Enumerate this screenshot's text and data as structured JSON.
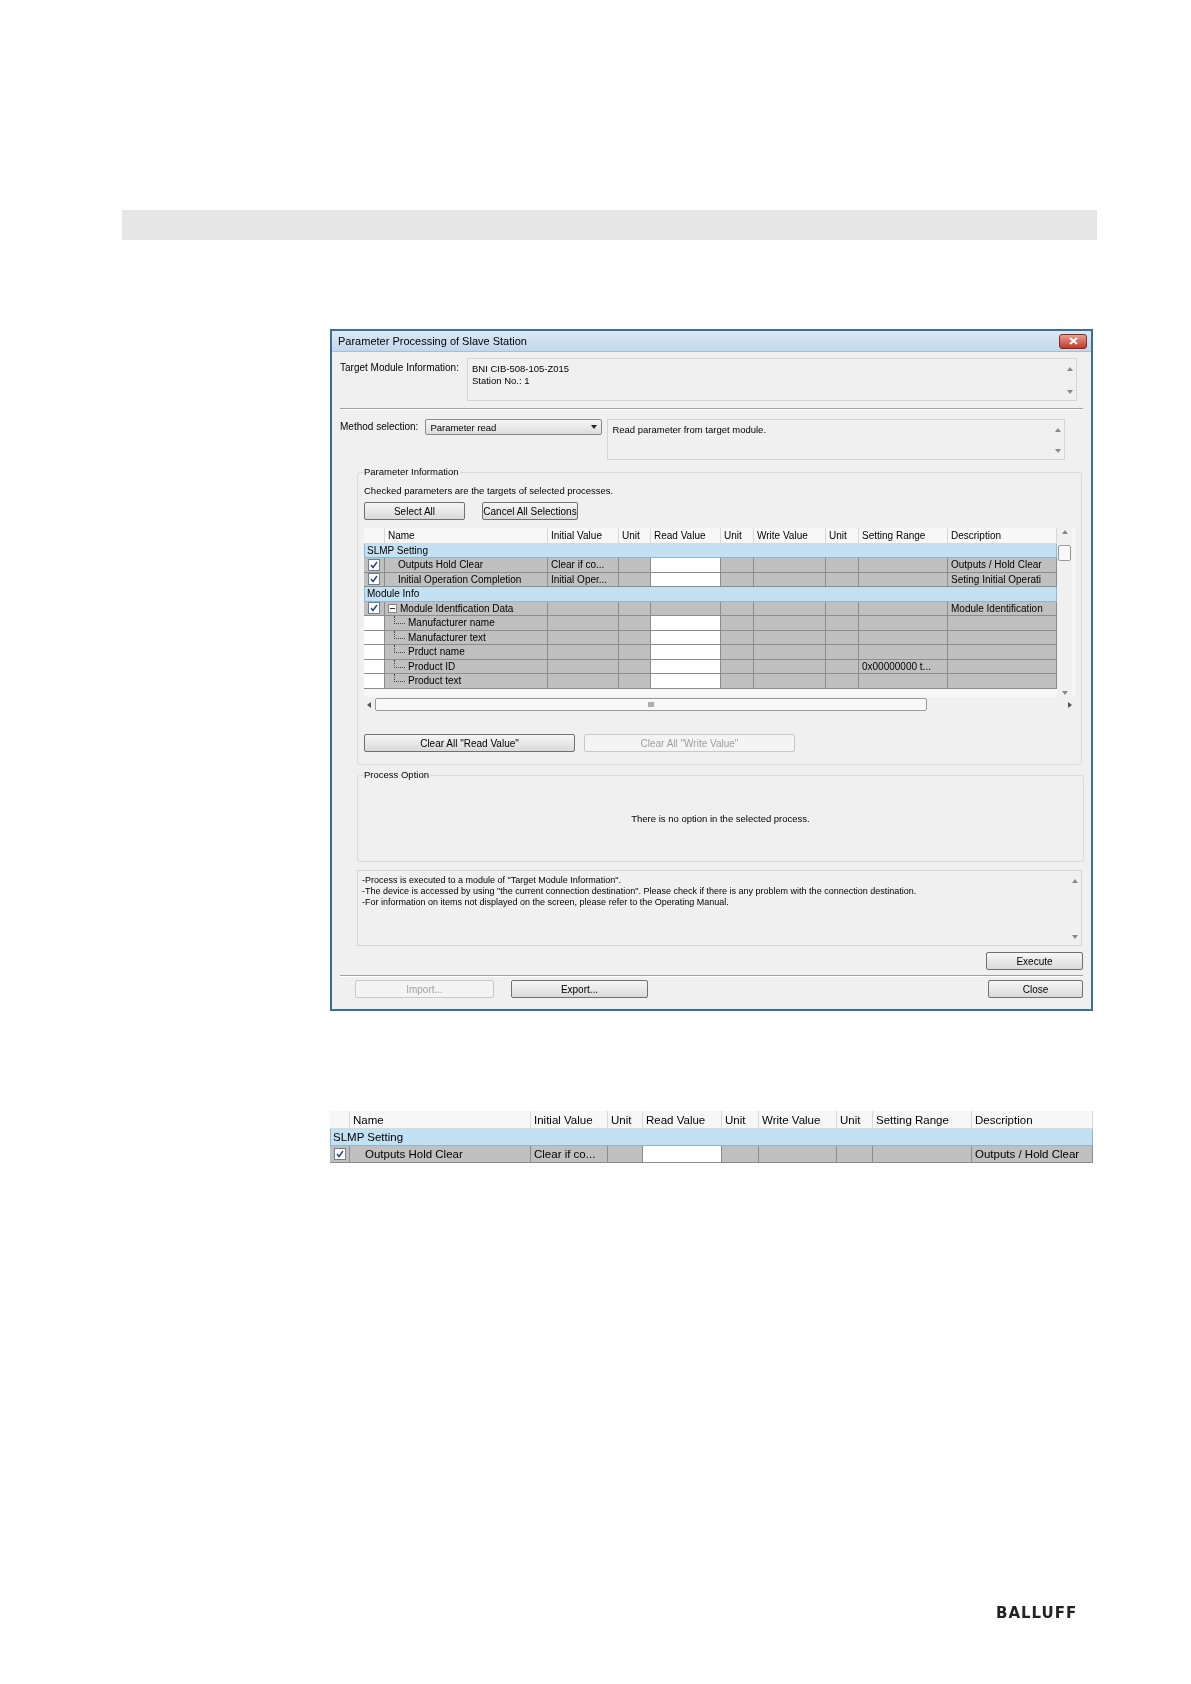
{
  "dialog": {
    "title": "Parameter Processing of Slave Station",
    "target_module": {
      "label": "Target Module Information:",
      "lines": [
        "BNI CIB-508-105-Z015",
        "Station No.: 1"
      ]
    },
    "method": {
      "label": "Method selection:",
      "value": "Parameter read",
      "description": "Read parameter from target module."
    },
    "parameter_information": {
      "title": "Parameter Information",
      "hint": "Checked parameters are the targets of selected processes.",
      "buttons": [
        {
          "label": "Select All",
          "disabled": false
        },
        {
          "label": "Cancel All Selections",
          "disabled": false
        }
      ],
      "table": {
        "columns": [
          "Name",
          "Initial Value",
          "Unit",
          "Read Value",
          "Unit",
          "Write Value",
          "Unit",
          "Setting Range",
          "Description"
        ],
        "groups": [
          {
            "group": "SLMP Setting",
            "parameters": [
              {
                "name": "Outputs Hold Clear",
                "checked": true,
                "initial_value": "Clear if co...",
                "read_editable": true,
                "description": "Outputs / Hold Clear"
              },
              {
                "name": "Initial Operation Completion",
                "checked": true,
                "initial_value": "Initial Oper...",
                "read_editable": true,
                "description": "Seting Initial Operati"
              }
            ]
          },
          {
            "group": "Module Info",
            "parameters": [
              {
                "name": "Module Identfication Data",
                "checked": true,
                "read_editable": false,
                "expanded": true,
                "description": "Module Identification",
                "children": [
                  {
                    "name": "Manufacturer name",
                    "read_editable": true
                  },
                  {
                    "name": "Manufacturer text",
                    "read_editable": true
                  },
                  {
                    "name": "Prduct name",
                    "read_editable": true
                  },
                  {
                    "name": "Product ID",
                    "read_editable": true,
                    "setting_range": "0x00000000 t..."
                  },
                  {
                    "name": "Product text",
                    "read_editable": true
                  }
                ]
              }
            ]
          }
        ]
      },
      "clear_buttons": [
        {
          "label": "Clear All \"Read Value\"",
          "disabled": false
        },
        {
          "label": "Clear All \"Write Value\"",
          "disabled": true
        }
      ]
    },
    "process_option": {
      "title": "Process Option",
      "message": "There is no option in the selected process."
    },
    "notes": [
      "-Process is executed to a module of \"Target Module Information\".",
      "-The device is accessed by using \"the current connection destination\". Please check if there is any problem with the connection destination.",
      "-For information on items not displayed on the screen, please refer to the Operating Manual."
    ],
    "execute_button": {
      "label": "Execute",
      "disabled": false
    },
    "footer_buttons": [
      {
        "label": "Import...",
        "disabled": true
      },
      {
        "label": "Export...",
        "disabled": false
      },
      {
        "label": "Close",
        "disabled": false
      }
    ]
  },
  "example_table": {
    "columns": [
      "Name",
      "Initial Value",
      "Unit",
      "Read Value",
      "Unit",
      "Write Value",
      "Unit",
      "Setting Range",
      "Description"
    ],
    "groups": [
      {
        "group": "SLMP Setting",
        "parameters": [
          {
            "name": "Outputs Hold Clear",
            "checked": true,
            "initial_value": "Clear if co...",
            "read_editable": true,
            "description": "Outputs / Hold Clear"
          }
        ]
      }
    ]
  },
  "logo": "BALLUFF"
}
